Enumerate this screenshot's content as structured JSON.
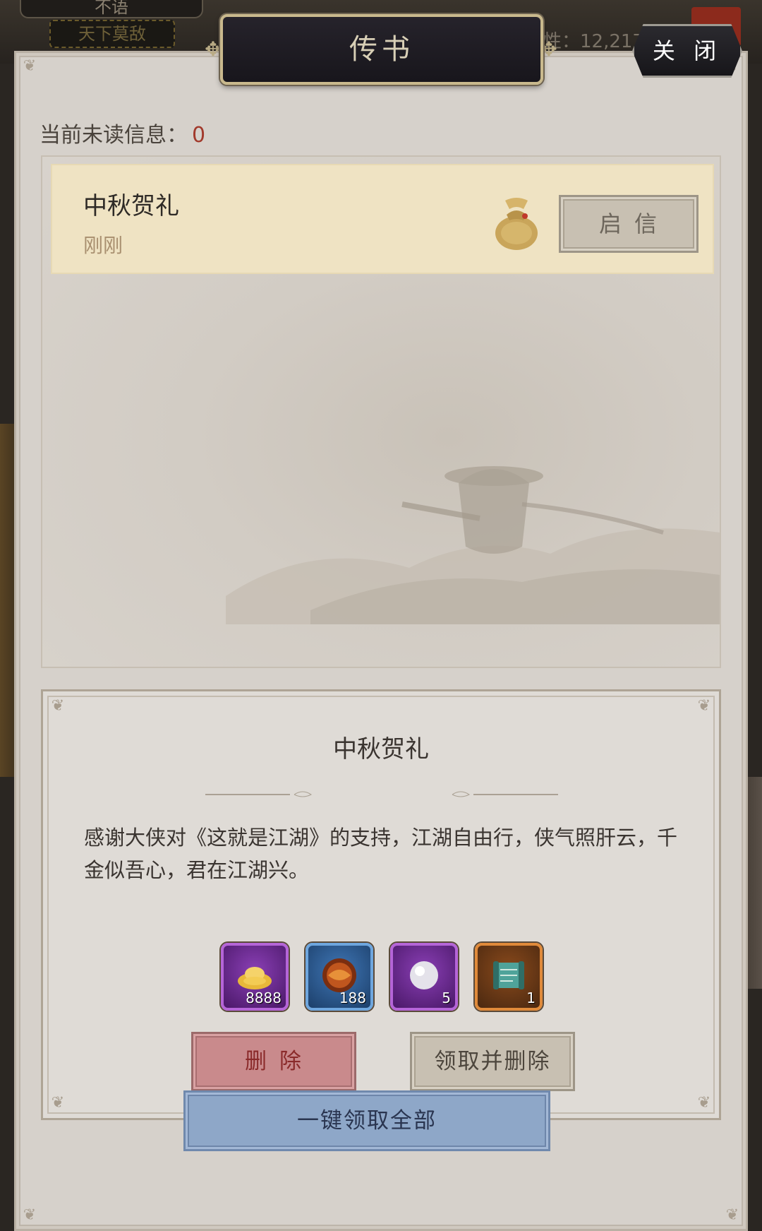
{
  "background": {
    "player_name": "不语",
    "player_title": "天下莫敌",
    "power_text": "性：12,217"
  },
  "window": {
    "title": "传书",
    "close_label": "关 闭"
  },
  "mailbox": {
    "unread_label": "当前未读信息：",
    "unread_count": "0",
    "items": [
      {
        "title": "中秋贺礼",
        "time": "刚刚",
        "open_label": "启信"
      }
    ]
  },
  "detail": {
    "title": "中秋贺礼",
    "body": "感谢大侠对《这就是江湖》的支持，江湖自由行，侠气照肝云，千金似吾心，君在江湖兴。",
    "rewards": [
      {
        "icon": "gold-ingot-icon",
        "quantity": "8888",
        "rarity": "purple"
      },
      {
        "icon": "fire-orb-icon",
        "quantity": "188",
        "rarity": "blue"
      },
      {
        "icon": "pearl-icon",
        "quantity": "5",
        "rarity": "purple"
      },
      {
        "icon": "scroll-icon",
        "quantity": "1",
        "rarity": "orange"
      }
    ],
    "delete_label": "删除",
    "claim_delete_label": "领取并删除"
  },
  "footer": {
    "claim_all_label": "一键领取全部"
  }
}
